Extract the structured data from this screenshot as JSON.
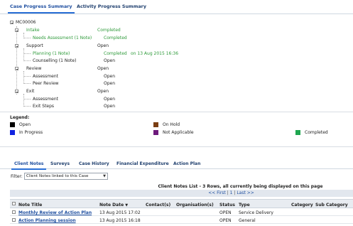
{
  "top_tabs": [
    {
      "label": "Case Progress Summary",
      "active": true
    },
    {
      "label": "Activity Progress Summary",
      "active": false
    }
  ],
  "tree": {
    "root": "MC00006",
    "nodes": [
      {
        "label": "Intake",
        "status": "Completed",
        "green": true,
        "date": ""
      },
      {
        "label": "Needs Assessment (1 Note)",
        "status": "Completed",
        "green": true,
        "date": ""
      },
      {
        "label": "Support",
        "status": "Open",
        "green": false,
        "date": ""
      },
      {
        "label": "Planning (1 Note)",
        "status": "Completed",
        "green": true,
        "date": "on 13 Aug 2015 16:36"
      },
      {
        "label": "Counselling (1 Note)",
        "status": "Open",
        "green": false,
        "date": ""
      },
      {
        "label": "Review",
        "status": "Open",
        "green": false,
        "date": ""
      },
      {
        "label": "Assessment",
        "status": "Open",
        "green": false,
        "date": ""
      },
      {
        "label": "Peer Review",
        "status": "Open",
        "green": false,
        "date": ""
      },
      {
        "label": "Exit",
        "status": "Open",
        "green": false,
        "date": ""
      },
      {
        "label": "Assessment",
        "status": "Open",
        "green": false,
        "date": ""
      },
      {
        "label": "Exit Steps",
        "status": "Open",
        "green": false,
        "date": ""
      }
    ]
  },
  "legend": {
    "title": "Legend:",
    "items": [
      {
        "label": "Open",
        "color": "#000000"
      },
      {
        "label": "On Hold",
        "color": "#7a3e12"
      },
      {
        "label": "In Progress",
        "color": "#1023e0"
      },
      {
        "label": "Not Applicable",
        "color": "#6e1a7c"
      },
      {
        "label": "Completed",
        "color": "#1fa650"
      }
    ]
  },
  "bottom_tabs": [
    {
      "label": "Client Notes",
      "active": true
    },
    {
      "label": "Surveys",
      "active": false
    },
    {
      "label": "Case History",
      "active": false
    },
    {
      "label": "Financial Expenditure",
      "active": false
    },
    {
      "label": "Action Plan",
      "active": false
    }
  ],
  "filter": {
    "label": "Filter:",
    "value": "Client Notes linked to this Case"
  },
  "list_info": "Client Notes List - 3 Rows, all currently being displayed on this page",
  "pager": {
    "first": "<< First",
    "page": "1",
    "last": "Last >>"
  },
  "columns": [
    "Note Title",
    "Note Date",
    "Contact(s)",
    "Organisation(s)",
    "Status",
    "Type",
    "Category",
    "Sub Category"
  ],
  "rows": [
    {
      "title": "Monthly Review of Action Plan",
      "date": "13 Aug 2015 17:02",
      "status": "OPEN",
      "type": "Service Delivery"
    },
    {
      "title": "Action Planning session",
      "date": "13 Aug 2015 16:18",
      "status": "OPEN",
      "type": "General"
    }
  ],
  "colors": {
    "accent": "#2a6fd6",
    "link": "#1f4fa0",
    "completed_text": "#2e9a3a",
    "header_bg": "#e8ecf1"
  }
}
